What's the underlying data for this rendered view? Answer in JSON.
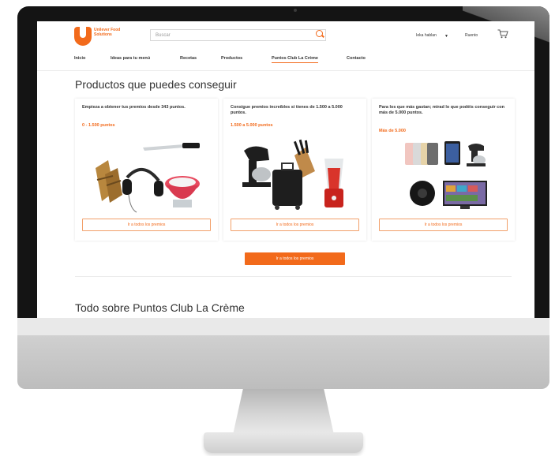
{
  "header": {
    "logo_text": "Unilever Food Solutions",
    "search_placeholder": "Buscar",
    "language": "Ieka hablan",
    "language_caret": "▼",
    "login": "Ruento"
  },
  "nav": {
    "items": [
      {
        "label": "Inicio"
      },
      {
        "label": "Ideas para tu menú"
      },
      {
        "label": "Recetas"
      },
      {
        "label": "Productos"
      },
      {
        "label": "Puntos Club La Crème"
      },
      {
        "label": "Contacto"
      }
    ],
    "active_index": 4
  },
  "main": {
    "title": "Productos que puedes conseguir",
    "cards": [
      {
        "description": "Empieza a obtener tus premios desde 343 puntos.",
        "range": "0 - 1.500 puntos",
        "button": "Ir a todos los premios"
      },
      {
        "description": "Consigue premios increíbles si tienes de 1.500 a 5.000 puntos.",
        "range": "1.500 a 5.000 puntos",
        "button": "Ir a todos los premios"
      },
      {
        "description": "Para los que más gastan; mirad lo que podéis conseguir con más de 5.000 puntos.",
        "range": "Más de 5.000",
        "button": "Ir a todos los premios"
      }
    ],
    "all_button": "Ir a todos los premios",
    "section2_title": "Todo sobre Puntos Club La Crème"
  },
  "colors": {
    "accent": "#f26a1b",
    "bezel": "#141414",
    "text": "#333333"
  }
}
